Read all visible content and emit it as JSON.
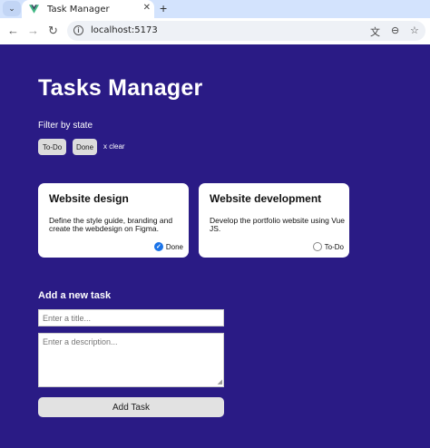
{
  "browser": {
    "tab_title": "Task Manager",
    "tab_menu_icon": "chevron-down-icon",
    "close_icon": "close-icon",
    "new_tab_icon": "plus-icon",
    "url": "localhost:5173"
  },
  "page": {
    "title": "Tasks Manager",
    "filter": {
      "label": "Filter by state",
      "options": [
        "To-Do",
        "Done"
      ],
      "clear_label": "x clear"
    },
    "tasks": [
      {
        "title": "Website design",
        "description": "Define the style guide, branding and create the webdesign on Figma.",
        "state": "Done"
      },
      {
        "title": "Website development",
        "description": "Develop the portfolio website using Vue JS.",
        "state": "To-Do"
      }
    ],
    "form": {
      "heading": "Add a new task",
      "title_placeholder": "Enter a title...",
      "description_placeholder": "Enter a description...",
      "submit_label": "Add Task"
    }
  },
  "colors": {
    "page_background": "#2a1b85",
    "done_accent": "#1a73e8",
    "browser_tabstrip": "#d3e3fd"
  }
}
